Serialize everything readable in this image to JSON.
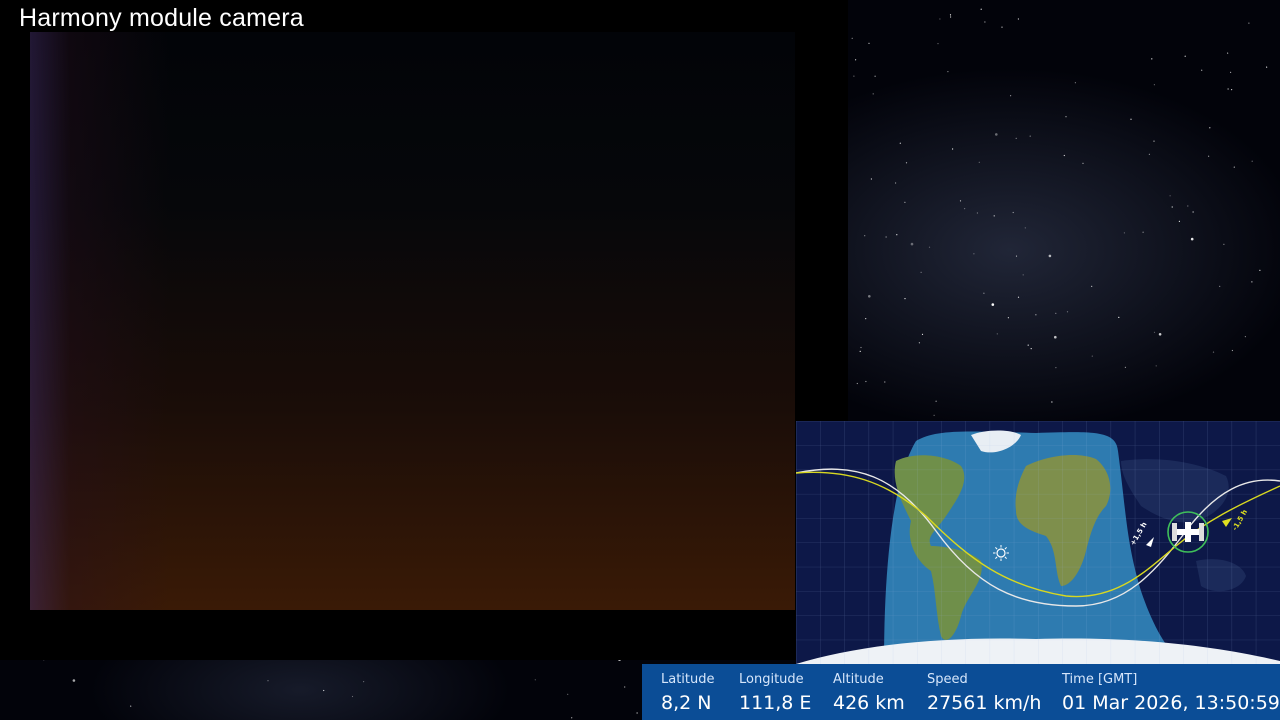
{
  "camera": {
    "title": "Harmony module camera"
  },
  "map": {
    "track_labels": [
      "+1,5 h",
      "-1,5 h"
    ],
    "colors": {
      "night": "#0d1848",
      "ocean": "#2e7bb0",
      "land": "#6f8f4a",
      "past_track": "#e8e8e8",
      "future_track": "#d8d820",
      "station_ring": "#3fbf5a"
    }
  },
  "telemetry": {
    "items": [
      {
        "label": "Latitude",
        "value": "8,2 N"
      },
      {
        "label": "Longitude",
        "value": "111,8 E"
      },
      {
        "label": "Altitude",
        "value": "426 km"
      },
      {
        "label": "Speed",
        "value": "27561 km/h"
      },
      {
        "label": "Time [GMT]",
        "value": "01 Mar 2026, 13:50:59"
      }
    ],
    "colors": {
      "background": "#0b4d96",
      "label": "#d6e6fb",
      "value": "#ffffff"
    }
  }
}
